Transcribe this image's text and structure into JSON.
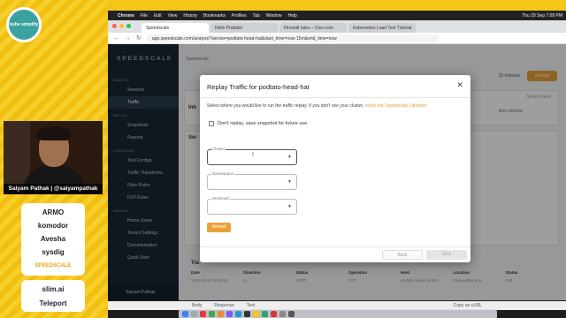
{
  "stream": {
    "logo_text": "kube simplify",
    "presenter": "Saiyam Pathak | @saiyampathak",
    "sponsors": [
      "ARMO",
      "komodor",
      "Avesha",
      "sysdig",
      "SPEEDSCALE"
    ],
    "sponsors2": [
      "slim.ai",
      "Teleport"
    ]
  },
  "macbar": {
    "apple": "",
    "menus": [
      "Chrome",
      "File",
      "Edit",
      "View",
      "History",
      "Bookmarks",
      "Profiles",
      "Tab",
      "Window",
      "Help"
    ],
    "clock": "Thu 29 Sep 7:08 PM"
  },
  "browser": {
    "tabs": [
      "Speedscale",
      "Hello Podtato!",
      "Firewall rules – Civo.com",
      "Kubernetes Load Test Tutorial"
    ],
    "url": "app.speedscale.com/analyze?service=podtato-head-hat&start_time=now-15m&end_time=now"
  },
  "sidebar": {
    "brand": "SPEEDSCALE",
    "sections": [
      {
        "title": "ANALYZE",
        "items": [
          "Services",
          "Traffic"
        ]
      },
      {
        "title": "REPLAY",
        "items": [
          "Snapshots",
          "Reports"
        ]
      },
      {
        "title": "CONFIGURE",
        "items": [
          "Test Configs",
          "Traffic Transforms",
          "Filter Rules",
          "DLP Rules"
        ]
      },
      {
        "title": "MANAGE",
        "items": [
          "Home Users",
          "Tenant Settings",
          "Documentation",
          "Quick Start"
        ]
      }
    ],
    "active_item": "Traffic",
    "user": "Saiyam Pathak"
  },
  "main": {
    "breadcrumb": "Speedscale",
    "range_label": "15 minutes",
    "record_label": "Record",
    "sections": [
      "Inb",
      "Ser"
    ],
    "show_filters": "Show Filters",
    "filter_hint": "time window",
    "table_title": "Tra",
    "table_headers": [
      "Date",
      "Direction",
      "Status",
      "Operation",
      "Host",
      "Location",
      "Status"
    ],
    "table_row": [
      "2022-09-29 19:08:44",
      "In",
      "HTTP",
      "GET",
      "podtato-head-hat.80/",
      "/images/hat.png",
      "200"
    ],
    "bottom_tabs": [
      "Body",
      "Response",
      "Test"
    ],
    "copy_label": "Copy as cURL"
  },
  "modal": {
    "title": "Replay Traffic for podtato-head-hat",
    "description": "Select where you would like to run the traffic replay. If you don't see your cluster,",
    "install_link": "install the Speedscale Operator.",
    "checkbox_label": "Don't replay, save snapshot for future use.",
    "fields": [
      {
        "label": "Cluster",
        "value": ""
      },
      {
        "label": "Namespace",
        "value": ""
      },
      {
        "label": "Workload",
        "value": ""
      }
    ],
    "reload_label": "Reload",
    "back_label": "Back",
    "next_label": "Next"
  },
  "colors": {
    "accent": "#e9a137",
    "sidebar_bg": "#1b2733",
    "stream_bg": "#f5c518"
  }
}
